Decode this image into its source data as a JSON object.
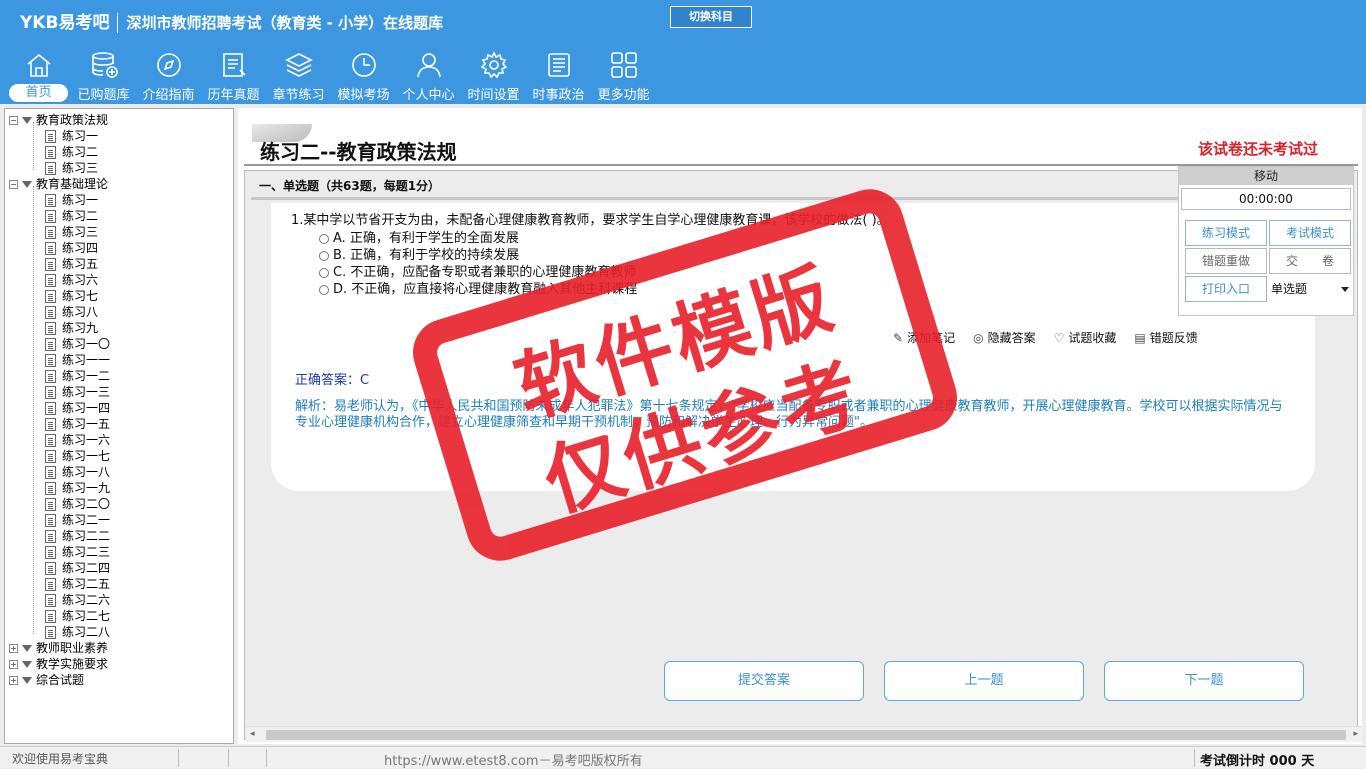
{
  "header": {
    "brand": "YKB易考吧",
    "subtitle": "深圳市教师招聘考试（教育类 - 小学）在线题库",
    "switch_label": "切换科目",
    "nav": [
      {
        "label": "首页",
        "icon": "home-icon"
      },
      {
        "label": "已购题库",
        "icon": "database-icon"
      },
      {
        "label": "介绍指南",
        "icon": "compass-icon"
      },
      {
        "label": "历年真题",
        "icon": "document-icon"
      },
      {
        "label": "章节练习",
        "icon": "layers-icon"
      },
      {
        "label": "模拟考场",
        "icon": "clock-icon"
      },
      {
        "label": "个人中心",
        "icon": "user-icon"
      },
      {
        "label": "时间设置",
        "icon": "gear-icon"
      },
      {
        "label": "时事政治",
        "icon": "newspaper-icon"
      },
      {
        "label": "更多功能",
        "icon": "grid-icon"
      }
    ]
  },
  "sidebar": {
    "group1": {
      "label": "教育政策法规",
      "items": [
        "练习一",
        "练习二",
        "练习三"
      ]
    },
    "group2": {
      "label": "教育基础理论",
      "items": [
        "练习一",
        "练习二",
        "练习三",
        "练习四",
        "练习五",
        "练习六",
        "练习七",
        "练习八",
        "练习九",
        "练习一〇",
        "练习一一",
        "练习一二",
        "练习一三",
        "练习一四",
        "练习一五",
        "练习一六",
        "练习一七",
        "练习一八",
        "练习一九",
        "练习二〇",
        "练习二一",
        "练习二二",
        "练习二三",
        "练习二四",
        "练习二五",
        "练习二六",
        "练习二七",
        "练习二八"
      ]
    },
    "group3": {
      "label": "教师职业素养"
    },
    "group4": {
      "label": "教学实施要求"
    },
    "group5": {
      "label": "综合试题"
    }
  },
  "main": {
    "title": "练习二--教育政策法规",
    "status": "该试卷还未考试过",
    "section": "一、单选题（共63题，每题1分）",
    "question": "1.某中学以节省开支为由，未配备心理健康教育教师，要求学生自学心理健康教育课，该学校的做法(  )。",
    "options": [
      "A. 正确，有利于学生的全面发展",
      "B. 正确，有利于学校的持续发展",
      "C. 不正确，应配备专职或者兼职的心理健康教育教师",
      "D. 不正确，应直接将心理健康教育融入其他主科课程"
    ],
    "actions": {
      "note": "添加笔记",
      "hide": "隐藏答案",
      "fav": "试题收藏",
      "feedback": "错题反馈"
    },
    "answer": "正确答案：C",
    "analysis": "解析：易老师认为，《中华人民共和国预防未成年人犯罪法》第十七条规定，\"学校应当配备专职或者兼职的心理健康教育教师，开展心理健康教育。学校可以根据实际情况与专业心理健康机构合作，建立心理健康筛查和早期干预机制，预防和解决学生心理、行为异常问题\"。",
    "submit": "提交答案",
    "prev": "上一题",
    "next": "下一题"
  },
  "panel": {
    "move": "移动",
    "timer": "00:00:00",
    "practice_mode": "练习模式",
    "exam_mode": "考试模式",
    "redo_wrong": "错题重做",
    "hand_in": "交　　卷",
    "print": "打印入口",
    "qtype": "单选题"
  },
  "stamp": {
    "line1": "软件模版",
    "line2": "仅供参考"
  },
  "statusbar": {
    "welcome": "欢迎使用易考宝典",
    "url": "https://www.etest8.com－易考吧版权所有",
    "countdown": "考试倒计时 000 天"
  },
  "colors": {
    "header": "#3c97e0",
    "stamp": "#e8202a",
    "status_red": "#d8222a"
  }
}
